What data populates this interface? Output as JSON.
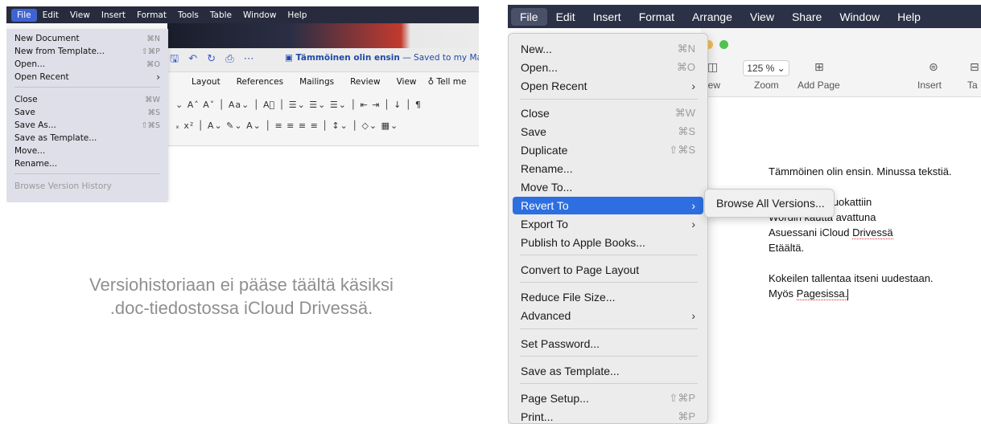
{
  "word": {
    "menubar": [
      "File",
      "Edit",
      "View",
      "Insert",
      "Format",
      "Tools",
      "Table",
      "Window",
      "Help"
    ],
    "doc_title": "Tämmöinen olin ensin",
    "doc_saved": " — Saved to my Mac",
    "ribbon_tabs": [
      "Layout",
      "References",
      "Mailings",
      "Review",
      "View"
    ],
    "tell_me": "Tell me",
    "file_menu": [
      {
        "label": "New Document",
        "shortcut": "⌘N"
      },
      {
        "label": "New from Template...",
        "shortcut": "⇧⌘P"
      },
      {
        "label": "Open...",
        "shortcut": "⌘O"
      },
      {
        "label": "Open Recent",
        "shortcut": "›"
      },
      {
        "label": "Close",
        "shortcut": "⌘W"
      },
      {
        "label": "Save",
        "shortcut": "⌘S"
      },
      {
        "label": "Save As...",
        "shortcut": "⇧⌘S"
      },
      {
        "label": "Save as Template...",
        "shortcut": ""
      },
      {
        "label": "Move...",
        "shortcut": ""
      },
      {
        "label": "Rename...",
        "shortcut": ""
      },
      {
        "label": "Browse Version History",
        "shortcut": ""
      }
    ]
  },
  "caption": {
    "line1": "Versiohistoriaan ei pääse täältä käsiksi",
    "line2": ".doc-tiedostossa iCloud Drivessä."
  },
  "pages": {
    "menubar": [
      "File",
      "Edit",
      "Insert",
      "Format",
      "Arrange",
      "View",
      "Share",
      "Window",
      "Help"
    ],
    "toolbar": {
      "zoom_value": "125 %",
      "view_label": "iew",
      "zoom_label": "Zoom",
      "add_page_label": "Add Page",
      "insert_label": "Insert",
      "table_label": "Ta"
    },
    "file_menu": [
      {
        "label": "New...",
        "shortcut": "⌘N"
      },
      {
        "label": "Open...",
        "shortcut": "⌘O"
      },
      {
        "label": "Open Recent",
        "shortcut": "›"
      },
      {
        "label": "Close",
        "shortcut": "⌘W"
      },
      {
        "label": "Save",
        "shortcut": "⌘S"
      },
      {
        "label": "Duplicate",
        "shortcut": "⇧⌘S"
      },
      {
        "label": "Rename...",
        "shortcut": ""
      },
      {
        "label": "Move To...",
        "shortcut": ""
      },
      {
        "label": "Revert To",
        "shortcut": "›"
      },
      {
        "label": "Export To",
        "shortcut": "›"
      },
      {
        "label": "Publish to Apple Books...",
        "shortcut": ""
      },
      {
        "label": "Convert to Page Layout",
        "shortcut": ""
      },
      {
        "label": "Reduce File Size...",
        "shortcut": ""
      },
      {
        "label": "Advanced",
        "shortcut": "›"
      },
      {
        "label": "Set Password...",
        "shortcut": ""
      },
      {
        "label": "Save as Template...",
        "shortcut": ""
      },
      {
        "label": "Page Setup...",
        "shortcut": "⇧⌘P"
      },
      {
        "label": "Print...",
        "shortcut": "⌘P"
      }
    ],
    "revert_submenu": {
      "label": "Browse All Versions..."
    },
    "document_lines": [
      "Tämmöinen olin ensin. Minussa tekstiä.",
      "",
      "muokattiin",
      "Wordin kautta avattuna",
      "Asuessani iCloud ",
      "Drivessä",
      "Etäältä.",
      "",
      "Kokeilen tallentaa itseni uudestaan.",
      "Myös ",
      "Pagesissa."
    ]
  }
}
